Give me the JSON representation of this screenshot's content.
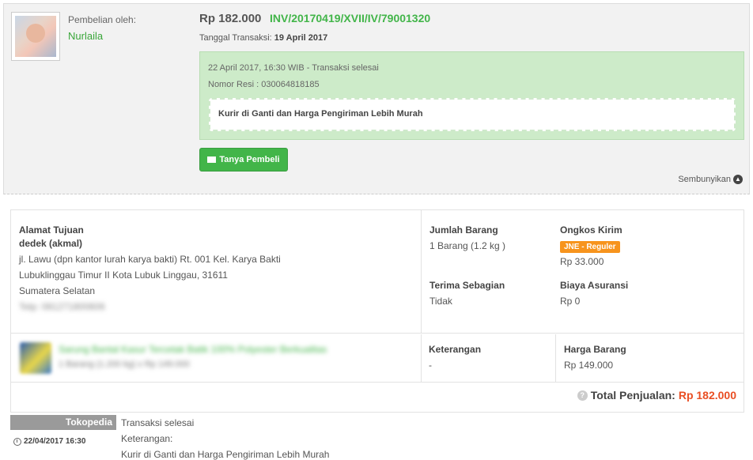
{
  "buyer": {
    "label": "Pembelian oleh:",
    "name": "Nurlaila"
  },
  "order": {
    "price": "Rp 182.000",
    "invoice": "INV/20170419/XVII/IV/79001320",
    "date_label": "Tanggal Transaksi:",
    "date_value": "19 April 2017"
  },
  "status_box": {
    "line1": "22 April 2017, 16:30 WIB - Transaksi selesai",
    "line2": "Nomor Resi : 030064818185",
    "note": "Kurir di Ganti dan Harga Pengiriman Lebih Murah"
  },
  "ask_button": "Tanya Pembeli",
  "hide_link": "Sembunyikan",
  "address": {
    "heading": "Alamat Tujuan",
    "name": "dedek (akmal)",
    "line1": "jl. Lawu (dpn kantor lurah karya bakti) Rt. 001 Kel. Karya Bakti",
    "line2": "Lubuklinggau Timur II Kota Lubuk Linggau, 31611",
    "line3": "Sumatera Selatan",
    "phone": "Telp: 081271800606"
  },
  "quantity": {
    "label": "Jumlah Barang",
    "value": "1 Barang (1.2 kg )"
  },
  "shipping": {
    "label": "Ongkos Kirim",
    "courier": "JNE - Reguler",
    "value": "Rp 33.000"
  },
  "partial": {
    "label": "Terima Sebagian",
    "value": "Tidak"
  },
  "insurance": {
    "label": "Biaya Asuransi",
    "value": "Rp 0"
  },
  "product": {
    "name": "Sarung Bantal Kasur Tercetak Batik 100% Polyester Berkualitas",
    "qty": "1 Barang (1.200 kg) x Rp 149.000"
  },
  "note": {
    "label": "Keterangan",
    "value": "-"
  },
  "item_price": {
    "label": "Harga Barang",
    "value": "Rp 149.000"
  },
  "total": {
    "label": "Total Penjualan:",
    "value": "Rp 182.000"
  },
  "history": {
    "tag": "Tokopedia",
    "date": "22/04/2017 16:30",
    "status": "Transaksi selesai",
    "note_label": "Keterangan:",
    "note": "Kurir di Ganti dan Harga Pengiriman Lebih Murah"
  },
  "colors": {
    "brand_green": "#42b549",
    "courier_orange": "#f7941d",
    "total_red": "#e94e23",
    "status_bg": "#cdebc9"
  }
}
